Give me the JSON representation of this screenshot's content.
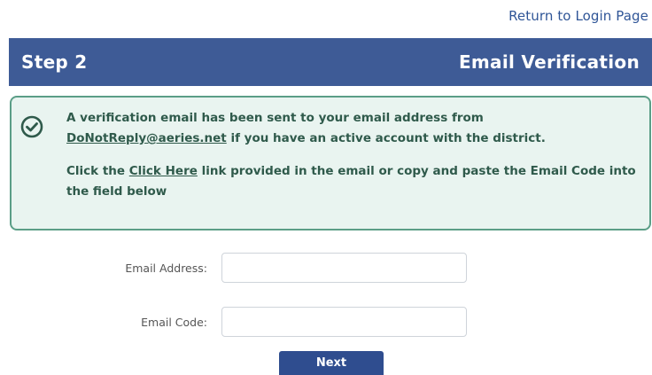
{
  "header_link": {
    "return_label": "Return to Login Page"
  },
  "step_header": {
    "step": "Step 2",
    "title": "Email Verification",
    "color": "#3e5b96"
  },
  "alert": {
    "icon": "check-circle-icon",
    "line1_prefix": "A verification email has been sent to your email address from",
    "sender_email": "DoNotReply@aeries.net",
    "line1_suffix": " if you have an active account with the district.",
    "line2_prefix": "Click the ",
    "click_here": "Click Here",
    "line2_suffix": " link provided in the email or copy and paste the Email Code into the field below",
    "color": "#5b9e87"
  },
  "form": {
    "email_address_label": "Email Address:",
    "email_address_value": "",
    "email_code_label": "Email Code:",
    "email_code_value": ""
  },
  "actions": {
    "next_label": "Next"
  }
}
